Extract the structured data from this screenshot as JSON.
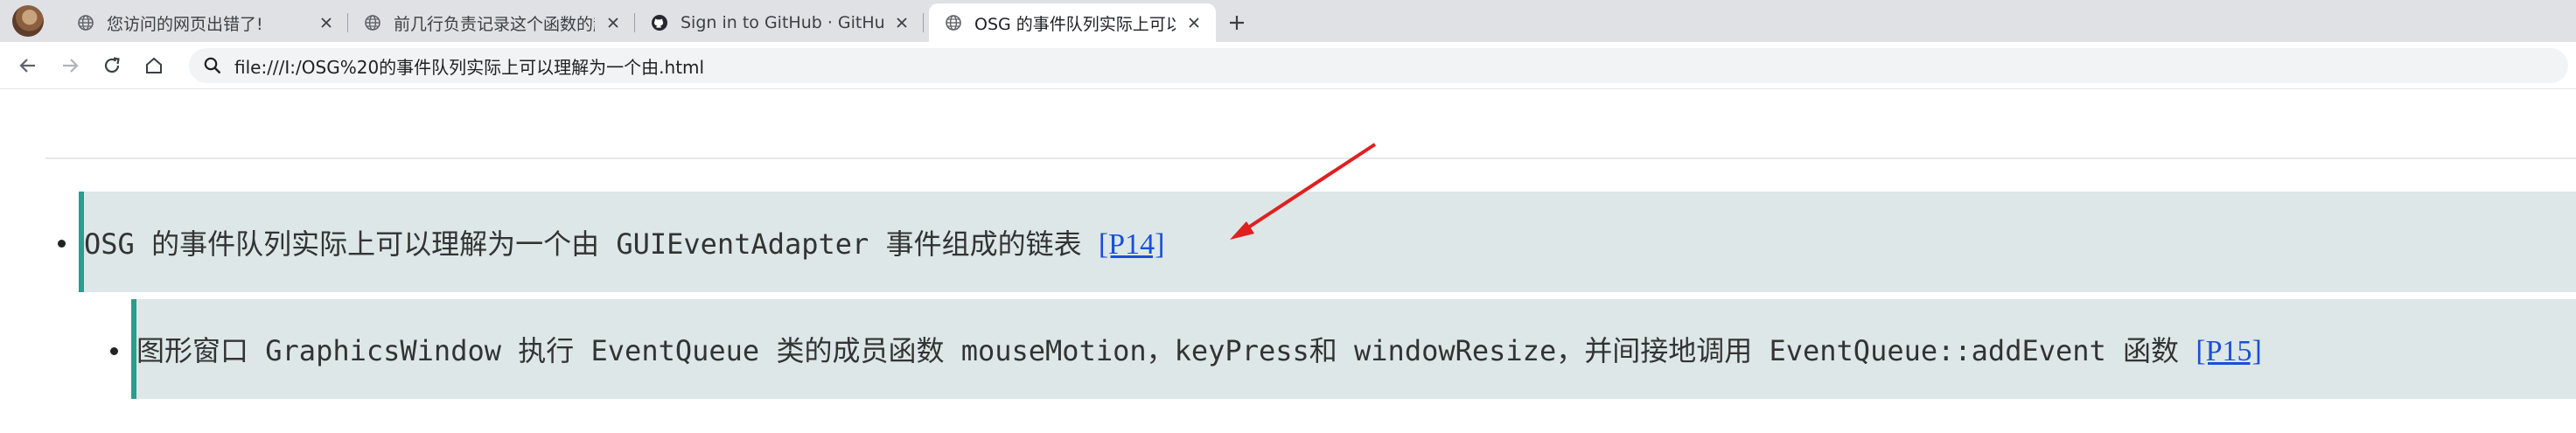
{
  "browser": {
    "tabs": [
      {
        "title": "您访问的网页出错了!",
        "icon": "globe-icon",
        "active": false
      },
      {
        "title": "前几行负责记录这个函数的起",
        "icon": "globe-icon",
        "active": false
      },
      {
        "title": "Sign in to GitHub · GitHub",
        "icon": "github-icon",
        "active": false
      },
      {
        "title": "OSG 的事件队列实际上可以",
        "icon": "globe-icon",
        "active": true
      }
    ],
    "address": "file:///I:/OSG%20的事件队列实际上可以理解为一个由.html"
  },
  "page": {
    "item1": {
      "text": "OSG 的事件队列实际上可以理解为一个由 GUIEventAdapter 事件组成的链表 ",
      "link": "[P14]"
    },
    "item2": {
      "text": "图形窗口 GraphicsWindow 执行 EventQueue 类的成员函数 mouseMotion，keyPress和 windowResize，并间接地调用 EventQueue::addEvent 函数 ",
      "link": "[P15]"
    }
  },
  "colors": {
    "blockquote_bg": "#dde7e7",
    "blockquote_border": "#2a9d8f",
    "link": "#1a4fd6",
    "annotation_arrow": "#e02020"
  }
}
